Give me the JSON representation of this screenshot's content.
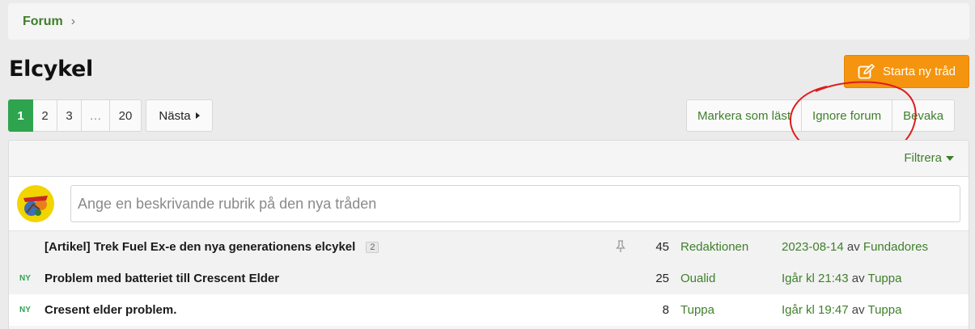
{
  "breadcrumb": {
    "forum": "Forum",
    "separator": "›"
  },
  "page": {
    "title": "Elcykel"
  },
  "new_thread_button": {
    "label": "Starta ny tråd",
    "icon": "edit-icon"
  },
  "pagination": {
    "pages": [
      "1",
      "2",
      "3",
      "…",
      "20"
    ],
    "current": "1",
    "next_label": "Nästa"
  },
  "actions": {
    "mark_read": "Markera som läst",
    "ignore": "Ignore forum",
    "watch": "Bevaka"
  },
  "filter": {
    "label": "Filtrera"
  },
  "quick_thread": {
    "placeholder": "Ange en beskrivande rubrik på den nya tråden"
  },
  "threads": [
    {
      "new": "",
      "title": "[Artikel] Trek Fuel Ex-e den nya generationens elcykel",
      "pages": "2",
      "sticky": true,
      "replies": "45",
      "author": "Redaktionen",
      "last_date": "2023-08-14",
      "by": "av",
      "last_user": "Fundadores"
    },
    {
      "new": "NY",
      "title": "Problem med batteriet till Crescent Elder",
      "pages": "",
      "sticky": false,
      "replies": "25",
      "author": "Oualid",
      "last_date": "Igår kl 21:43",
      "by": "av",
      "last_user": "Tuppa"
    },
    {
      "new": "NY",
      "title": "Cresent elder problem.",
      "pages": "",
      "sticky": false,
      "replies": "8",
      "author": "Tuppa",
      "last_date": "Igår kl 19:47",
      "by": "av",
      "last_user": "Tuppa"
    }
  ],
  "colors": {
    "accent_green": "#3f7f2b",
    "active_page": "#2ea44f",
    "orange_button": "#f5940f",
    "annotation_red": "#e01b1b"
  }
}
